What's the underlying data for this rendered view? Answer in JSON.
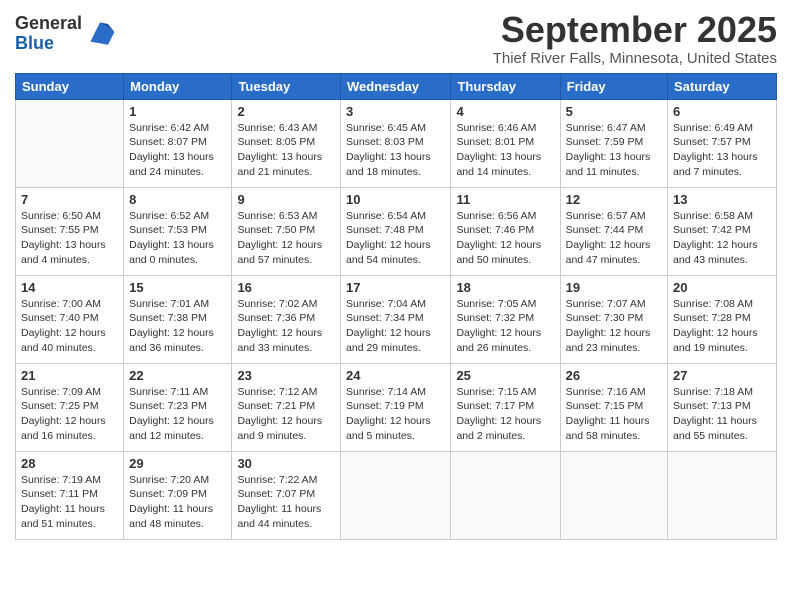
{
  "logo": {
    "general": "General",
    "blue": "Blue"
  },
  "title": "September 2025",
  "location": "Thief River Falls, Minnesota, United States",
  "days_of_week": [
    "Sunday",
    "Monday",
    "Tuesday",
    "Wednesday",
    "Thursday",
    "Friday",
    "Saturday"
  ],
  "weeks": [
    [
      {
        "day": "",
        "info": ""
      },
      {
        "day": "1",
        "info": "Sunrise: 6:42 AM\nSunset: 8:07 PM\nDaylight: 13 hours\nand 24 minutes."
      },
      {
        "day": "2",
        "info": "Sunrise: 6:43 AM\nSunset: 8:05 PM\nDaylight: 13 hours\nand 21 minutes."
      },
      {
        "day": "3",
        "info": "Sunrise: 6:45 AM\nSunset: 8:03 PM\nDaylight: 13 hours\nand 18 minutes."
      },
      {
        "day": "4",
        "info": "Sunrise: 6:46 AM\nSunset: 8:01 PM\nDaylight: 13 hours\nand 14 minutes."
      },
      {
        "day": "5",
        "info": "Sunrise: 6:47 AM\nSunset: 7:59 PM\nDaylight: 13 hours\nand 11 minutes."
      },
      {
        "day": "6",
        "info": "Sunrise: 6:49 AM\nSunset: 7:57 PM\nDaylight: 13 hours\nand 7 minutes."
      }
    ],
    [
      {
        "day": "7",
        "info": "Sunrise: 6:50 AM\nSunset: 7:55 PM\nDaylight: 13 hours\nand 4 minutes."
      },
      {
        "day": "8",
        "info": "Sunrise: 6:52 AM\nSunset: 7:53 PM\nDaylight: 13 hours\nand 0 minutes."
      },
      {
        "day": "9",
        "info": "Sunrise: 6:53 AM\nSunset: 7:50 PM\nDaylight: 12 hours\nand 57 minutes."
      },
      {
        "day": "10",
        "info": "Sunrise: 6:54 AM\nSunset: 7:48 PM\nDaylight: 12 hours\nand 54 minutes."
      },
      {
        "day": "11",
        "info": "Sunrise: 6:56 AM\nSunset: 7:46 PM\nDaylight: 12 hours\nand 50 minutes."
      },
      {
        "day": "12",
        "info": "Sunrise: 6:57 AM\nSunset: 7:44 PM\nDaylight: 12 hours\nand 47 minutes."
      },
      {
        "day": "13",
        "info": "Sunrise: 6:58 AM\nSunset: 7:42 PM\nDaylight: 12 hours\nand 43 minutes."
      }
    ],
    [
      {
        "day": "14",
        "info": "Sunrise: 7:00 AM\nSunset: 7:40 PM\nDaylight: 12 hours\nand 40 minutes."
      },
      {
        "day": "15",
        "info": "Sunrise: 7:01 AM\nSunset: 7:38 PM\nDaylight: 12 hours\nand 36 minutes."
      },
      {
        "day": "16",
        "info": "Sunrise: 7:02 AM\nSunset: 7:36 PM\nDaylight: 12 hours\nand 33 minutes."
      },
      {
        "day": "17",
        "info": "Sunrise: 7:04 AM\nSunset: 7:34 PM\nDaylight: 12 hours\nand 29 minutes."
      },
      {
        "day": "18",
        "info": "Sunrise: 7:05 AM\nSunset: 7:32 PM\nDaylight: 12 hours\nand 26 minutes."
      },
      {
        "day": "19",
        "info": "Sunrise: 7:07 AM\nSunset: 7:30 PM\nDaylight: 12 hours\nand 23 minutes."
      },
      {
        "day": "20",
        "info": "Sunrise: 7:08 AM\nSunset: 7:28 PM\nDaylight: 12 hours\nand 19 minutes."
      }
    ],
    [
      {
        "day": "21",
        "info": "Sunrise: 7:09 AM\nSunset: 7:25 PM\nDaylight: 12 hours\nand 16 minutes."
      },
      {
        "day": "22",
        "info": "Sunrise: 7:11 AM\nSunset: 7:23 PM\nDaylight: 12 hours\nand 12 minutes."
      },
      {
        "day": "23",
        "info": "Sunrise: 7:12 AM\nSunset: 7:21 PM\nDaylight: 12 hours\nand 9 minutes."
      },
      {
        "day": "24",
        "info": "Sunrise: 7:14 AM\nSunset: 7:19 PM\nDaylight: 12 hours\nand 5 minutes."
      },
      {
        "day": "25",
        "info": "Sunrise: 7:15 AM\nSunset: 7:17 PM\nDaylight: 12 hours\nand 2 minutes."
      },
      {
        "day": "26",
        "info": "Sunrise: 7:16 AM\nSunset: 7:15 PM\nDaylight: 11 hours\nand 58 minutes."
      },
      {
        "day": "27",
        "info": "Sunrise: 7:18 AM\nSunset: 7:13 PM\nDaylight: 11 hours\nand 55 minutes."
      }
    ],
    [
      {
        "day": "28",
        "info": "Sunrise: 7:19 AM\nSunset: 7:11 PM\nDaylight: 11 hours\nand 51 minutes."
      },
      {
        "day": "29",
        "info": "Sunrise: 7:20 AM\nSunset: 7:09 PM\nDaylight: 11 hours\nand 48 minutes."
      },
      {
        "day": "30",
        "info": "Sunrise: 7:22 AM\nSunset: 7:07 PM\nDaylight: 11 hours\nand 44 minutes."
      },
      {
        "day": "",
        "info": ""
      },
      {
        "day": "",
        "info": ""
      },
      {
        "day": "",
        "info": ""
      },
      {
        "day": "",
        "info": ""
      }
    ]
  ]
}
